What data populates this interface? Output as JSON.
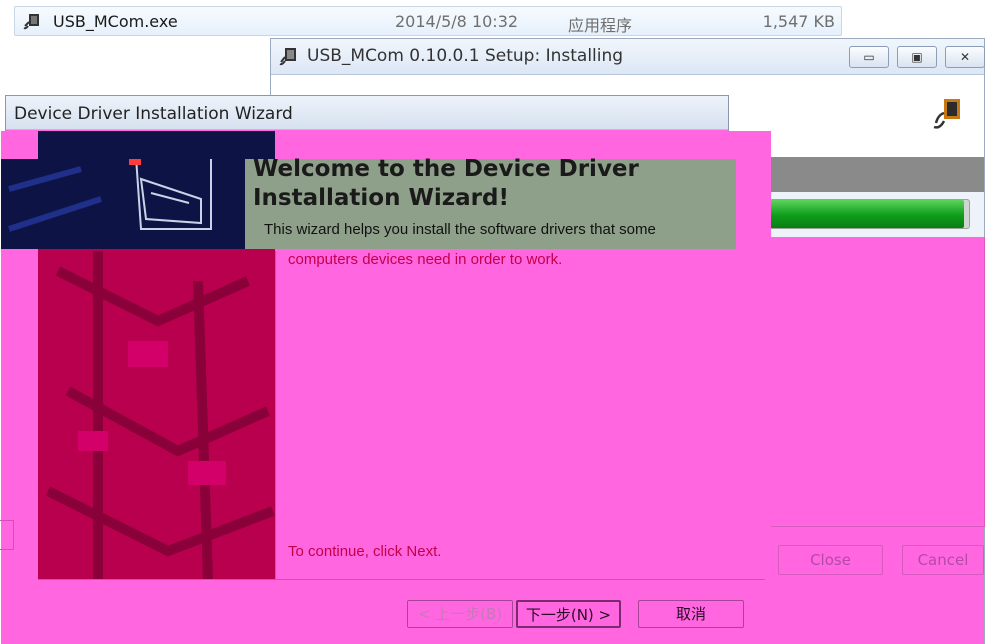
{
  "explorer_row": {
    "file_name": "USB_MCom.exe",
    "modified": "2014/5/8 10:32",
    "type": "应用程序",
    "size": "1,547 KB",
    "icon": "usb-app-icon"
  },
  "setup_window": {
    "title": "USB_MCom 0.10.0.1 Setup: Installing",
    "controls": {
      "minimize": "▭",
      "maximize": "▣",
      "close": "✕"
    },
    "progress": 0.98,
    "buttons": {
      "close": "Close",
      "cancel": "Cancel"
    },
    "icon": "usb-app-icon"
  },
  "wizard": {
    "title": "Device Driver Installation Wizard",
    "heading_line1": "Welcome to the Device Driver",
    "heading_line2": "Installation Wizard!",
    "description_line1": "This wizard helps you install the software drivers that some",
    "description_line2": "computers devices need in order to work.",
    "continue_text": "To continue, click Next.",
    "buttons": {
      "back": "< 上一步(B)",
      "next": "下一步(N) >",
      "cancel": "取消"
    },
    "icon": "device-drawer-icon"
  },
  "colors": {
    "accent_magenta": "#ff66e0",
    "side_panel": "#b8004f",
    "side_panel_dark": "#0d1445",
    "progress_green": "#0f9d1a"
  }
}
